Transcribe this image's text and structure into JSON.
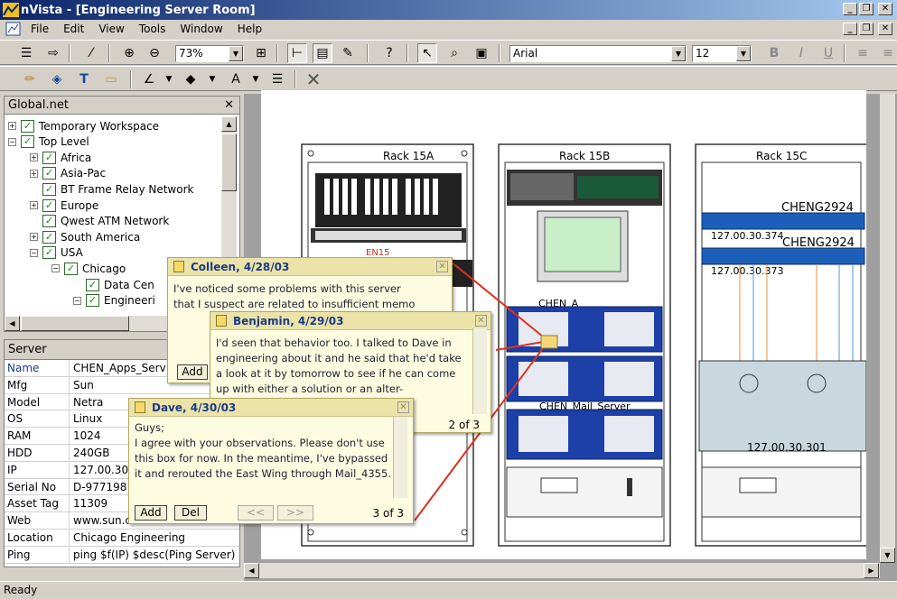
{
  "window": {
    "title": "nVista - [Engineering Server Room]"
  },
  "menu": [
    "File",
    "Edit",
    "View",
    "Tools",
    "Window",
    "Help"
  ],
  "toolbar": {
    "zoom": "73%",
    "font": "Arial",
    "font_size": "12"
  },
  "tree": {
    "title": "Global.net",
    "items": [
      {
        "label": "Temporary Workspace",
        "level": 0,
        "exp": "+"
      },
      {
        "label": "Top Level",
        "level": 0,
        "exp": "−"
      },
      {
        "label": "Africa",
        "level": 1,
        "exp": "+"
      },
      {
        "label": "Asia-Pac",
        "level": 1,
        "exp": "+"
      },
      {
        "label": "BT Frame Relay Network",
        "level": 1,
        "exp": ""
      },
      {
        "label": "Europe",
        "level": 1,
        "exp": "+"
      },
      {
        "label": "Qwest ATM Network",
        "level": 1,
        "exp": ""
      },
      {
        "label": "South America",
        "level": 1,
        "exp": "+"
      },
      {
        "label": "USA",
        "level": 1,
        "exp": "−"
      },
      {
        "label": "Chicago",
        "level": 2,
        "exp": "−"
      },
      {
        "label": "Data Cen",
        "level": 3,
        "exp": ""
      },
      {
        "label": "Engineeri",
        "level": 3,
        "exp": "−"
      }
    ]
  },
  "props": {
    "title": "Server",
    "rows": [
      {
        "k": "Name",
        "v": "CHEN_Apps_Serv"
      },
      {
        "k": "Mfg",
        "v": "Sun"
      },
      {
        "k": "Model",
        "v": "Netra"
      },
      {
        "k": "OS",
        "v": "Linux"
      },
      {
        "k": "RAM",
        "v": "1024"
      },
      {
        "k": "HDD",
        "v": "240GB"
      },
      {
        "k": "IP",
        "v": "127.00.30."
      },
      {
        "k": "Serial No",
        "v": "D-977198"
      },
      {
        "k": "Asset Tag",
        "v": "11309"
      },
      {
        "k": "Web",
        "v": "www.sun.com"
      },
      {
        "k": "Location",
        "v": "Chicago Engineering"
      },
      {
        "k": "Ping",
        "v": "ping $f(IP) $desc(Ping Server)"
      }
    ]
  },
  "racks": {
    "a": {
      "label": "Rack 15A",
      "device": "EN15"
    },
    "b": {
      "label": "Rack 15B",
      "apps": "CHEN_A",
      "mail": "CHEN_Mail_Server"
    },
    "c": {
      "label": "Rack 15C",
      "sw1": "CHENG2924",
      "sw1ip": "127.00.30.374",
      "sw2": "CHENG2924",
      "sw2ip": "127.00.30.373",
      "srvip": "127.00.30.301"
    }
  },
  "notes": [
    {
      "author": "Colleen, 4/28/03",
      "text": "I've noticed some problems with this server that I suspect are related to insufficient memo",
      "add": "Add"
    },
    {
      "author": "Benjamin, 4/29/03",
      "text": "I'd seen that behavior too. I talked to Dave in engineering about it and he said that he'd take a look at it by tomorrow to see if he can come up with either a solution or an alter-",
      "page": "2 of 3"
    },
    {
      "author": "Dave, 4/30/03",
      "text": "Guys;\nI agree with your observations. Please don't use this box for now. In the meantime, I've bypassed it and rerouted the East Wing through Mail_4355.",
      "add": "Add",
      "del": "Del",
      "prev": "<<",
      "next": ">>",
      "page": "3 of 3"
    }
  ],
  "status": "Ready"
}
